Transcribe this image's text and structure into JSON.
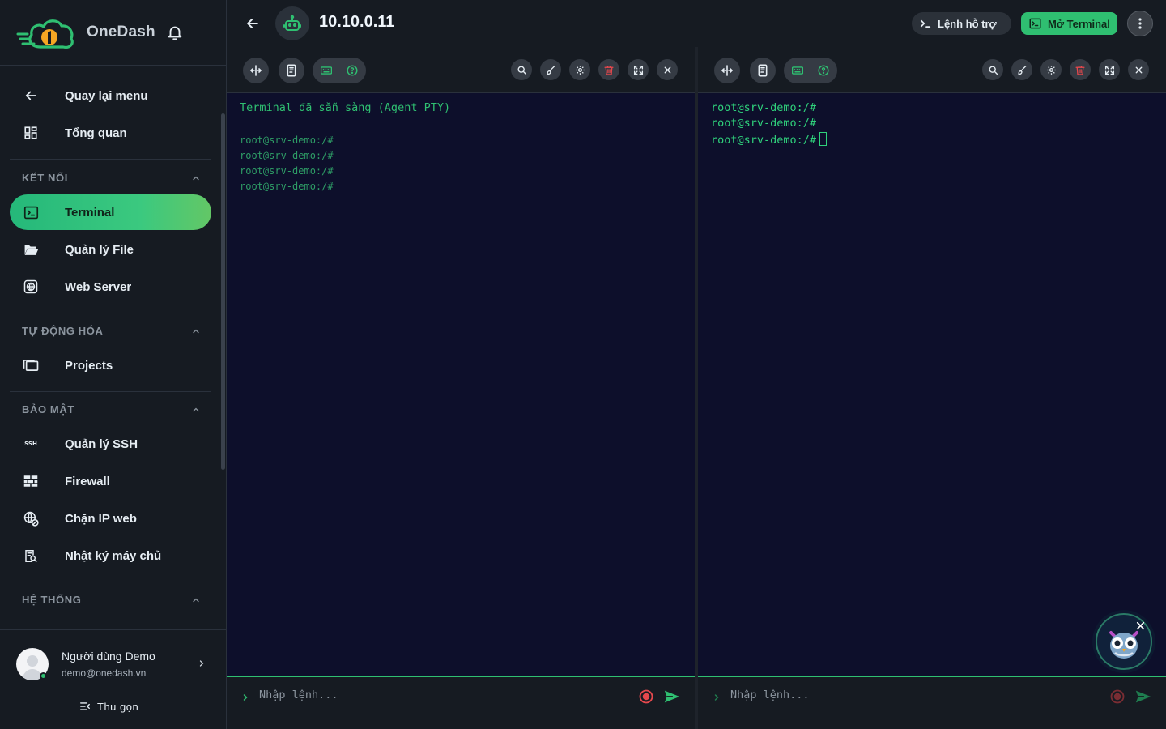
{
  "brand": {
    "name": "OneDash"
  },
  "sidebar": {
    "top_items": [
      {
        "label": "Quay lại menu",
        "icon": "arrow-left-icon"
      },
      {
        "label": "Tổng quan",
        "icon": "dashboard-grid-icon"
      }
    ],
    "sections": [
      {
        "title": "KẾT NỐI",
        "items": [
          {
            "label": "Terminal",
            "icon": "terminal-icon",
            "active": true
          },
          {
            "label": "Quản lý File",
            "icon": "folder-open-icon"
          },
          {
            "label": "Web Server",
            "icon": "globe-icon"
          }
        ]
      },
      {
        "title": "TỰ ĐỘNG HÓA",
        "items": [
          {
            "label": "Projects",
            "icon": "projects-icon"
          }
        ]
      },
      {
        "title": "BẢO MẬT",
        "items": [
          {
            "label": "Quản lý SSH",
            "icon": "ssh-icon",
            "icon_text": "SSH"
          },
          {
            "label": "Firewall",
            "icon": "firewall-brick-icon"
          },
          {
            "label": "Chặn IP web",
            "icon": "globe-block-icon"
          },
          {
            "label": "Nhật ký máy chủ",
            "icon": "log-search-icon"
          }
        ]
      },
      {
        "title": "HỆ THỐNG",
        "items": []
      }
    ],
    "user": {
      "name": "Người dùng Demo",
      "email": "demo@onedash.vn",
      "status": "online"
    },
    "collapse_label": "Thu gọn"
  },
  "header": {
    "server_name": "10.10.0.11",
    "help_label": "Lệnh hỗ trợ",
    "open_terminal_label": "Mở Terminal"
  },
  "panes": [
    {
      "ready_message": "Terminal đã sẵn sàng (Agent PTY)",
      "lines": [
        "root@srv-demo:/#",
        "root@srv-demo:/#",
        "root@srv-demo:/#",
        "root@srv-demo:/#"
      ],
      "input_placeholder": "Nhập lệnh..."
    },
    {
      "lines": [
        "root@srv-demo:/#",
        "root@srv-demo:/#",
        "root@srv-demo:/#"
      ],
      "input_placeholder": "Nhập lệnh..."
    }
  ],
  "colors": {
    "accent": "#2fbf71",
    "sidebar_bg": "#161b22",
    "terminal_bg": "#0d0f2b",
    "danger": "#e5484d"
  }
}
